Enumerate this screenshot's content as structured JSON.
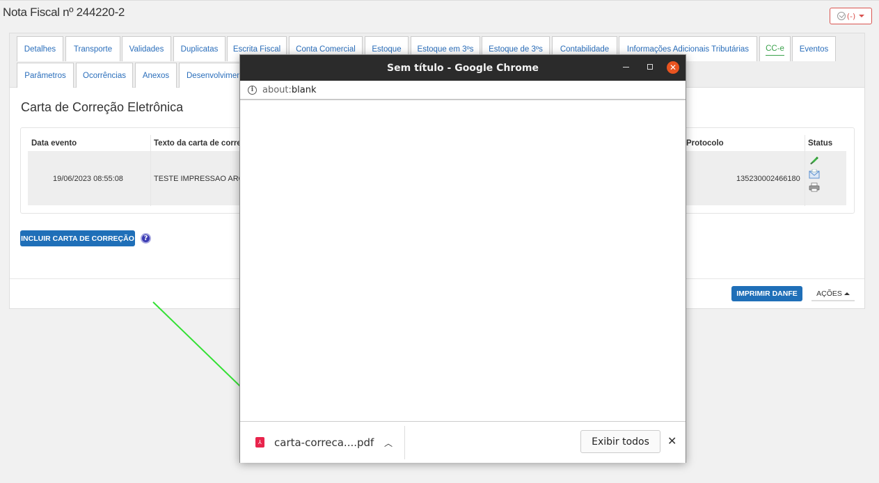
{
  "page": {
    "title": "Nota Fiscal nº 244220-2",
    "status_label": "(-)"
  },
  "tabs": [
    {
      "label": "Detalhes"
    },
    {
      "label": "Transporte"
    },
    {
      "label": "Validades"
    },
    {
      "label": "Duplicatas"
    },
    {
      "label": "Escrita Fiscal"
    },
    {
      "label": "Conta Comercial"
    },
    {
      "label": "Estoque"
    },
    {
      "label": "Estoque em 3ºs"
    },
    {
      "label": "Estoque de 3ºs"
    },
    {
      "label": "Contabilidade"
    },
    {
      "label": "Informações Adicionais Tributárias"
    },
    {
      "label": "CC-e"
    },
    {
      "label": "Eventos"
    },
    {
      "label": "Parâmetros"
    },
    {
      "label": "Ocorrências"
    },
    {
      "label": "Anexos"
    },
    {
      "label": "Desenvolvimen"
    }
  ],
  "section": {
    "title": "Carta de Correção Eletrônica"
  },
  "table": {
    "headers": [
      "Data evento",
      "Texto da carta de corre",
      "Protocolo",
      "Status"
    ],
    "rows": [
      {
        "data_evento": "19/06/2023 08:55:08",
        "texto": "TESTE IMPRESSAO ARQ I",
        "protocolo": "135230002466180"
      }
    ]
  },
  "buttons": {
    "incluir": "INCLUIR CARTA DE CORREÇÃO",
    "help": "?",
    "imprimir_danfe": "IMPRIMIR DANFE",
    "acoes": "AÇÕES"
  },
  "chrome_window": {
    "title": "Sem título - Google Chrome",
    "url_scheme": "about:",
    "url_path": "blank",
    "download": {
      "filename": "carta-correca....pdf",
      "show_all": "Exibir todos"
    }
  },
  "colors": {
    "primary_button": "#1f6fb8",
    "active_tab": "#3aa14b",
    "arrow": "#33e033",
    "chrome_close": "#e95420",
    "pdf_icon": "#e8244c"
  }
}
